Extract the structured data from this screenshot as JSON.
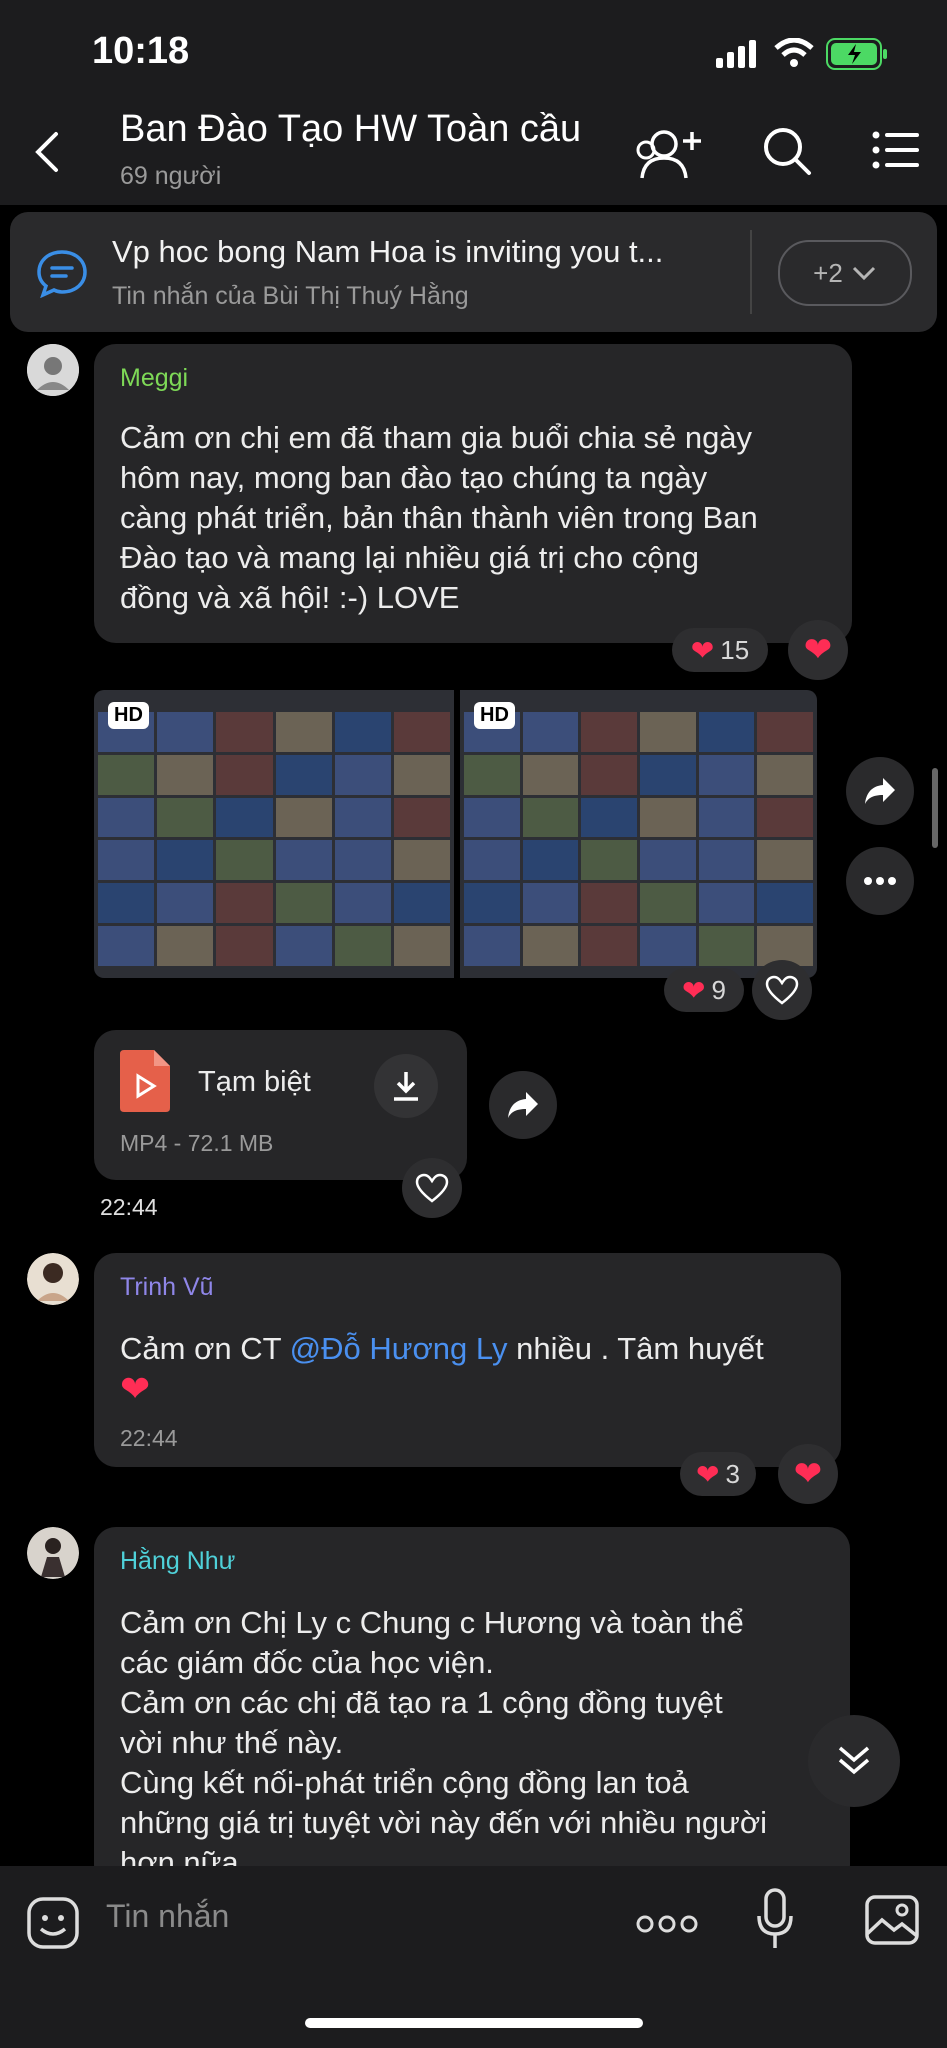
{
  "status_bar": {
    "time": "10:18"
  },
  "header": {
    "title": "Ban Đào Tạo HW Toàn cầu",
    "subtitle": "69 người"
  },
  "pinned": {
    "text": "Vp hoc bong Nam Hoa is inviting you t...",
    "sub": "Tin nhắn của Bùi Thị Thuý Hằng",
    "count": "+2"
  },
  "messages": {
    "meggi": {
      "sender": "Meggi",
      "line1": "Cảm ơn chị em đã tham gia buổi chia sẻ ngày",
      "line2": "hôm nay, mong ban đào tạo chúng ta ngày",
      "line3": "càng phát triển, bản thân thành viên trong Ban",
      "line4": "Đào tạo và mang lại nhiều giá trị cho cộng",
      "line5": "đồng và xã hội! :-) LOVE",
      "reactions": "15"
    },
    "photos": {
      "badge1": "HD",
      "badge2": "HD",
      "reactions": "9"
    },
    "file": {
      "name": "Tạm biệt",
      "meta": "MP4 - 72.1 MB",
      "time": "22:44"
    },
    "trinh": {
      "sender": "Trinh Vũ",
      "text_before": "Cảm ơn CT ",
      "mention": "@Đỗ Hương Ly",
      "text_after": "  nhiều . Tâm huyết",
      "time": "22:44",
      "reactions": "3"
    },
    "hang": {
      "sender": "Hằng Như",
      "line1": "Cảm ơn Chị Ly c Chung c Hương và toàn thể",
      "line2": "các giám đốc của học viện.",
      "line3": "Cảm ơn các chị đã tạo ra 1 cộng đồng tuyệt",
      "line4": "vời như thế này.",
      "line5": "Cùng kết nối-phát triển cộng đồng lan toả",
      "line6": "những giá trị tuyệt vời này đến với nhiều người",
      "line7": "hơn nữa."
    }
  },
  "input": {
    "placeholder": "Tin nhắn",
    "more": "ooo"
  },
  "colors": {
    "meggi": "#7ed957",
    "trinh": "#8f86e8",
    "hang": "#4fd1d9",
    "accent": "#3a8ee6"
  }
}
